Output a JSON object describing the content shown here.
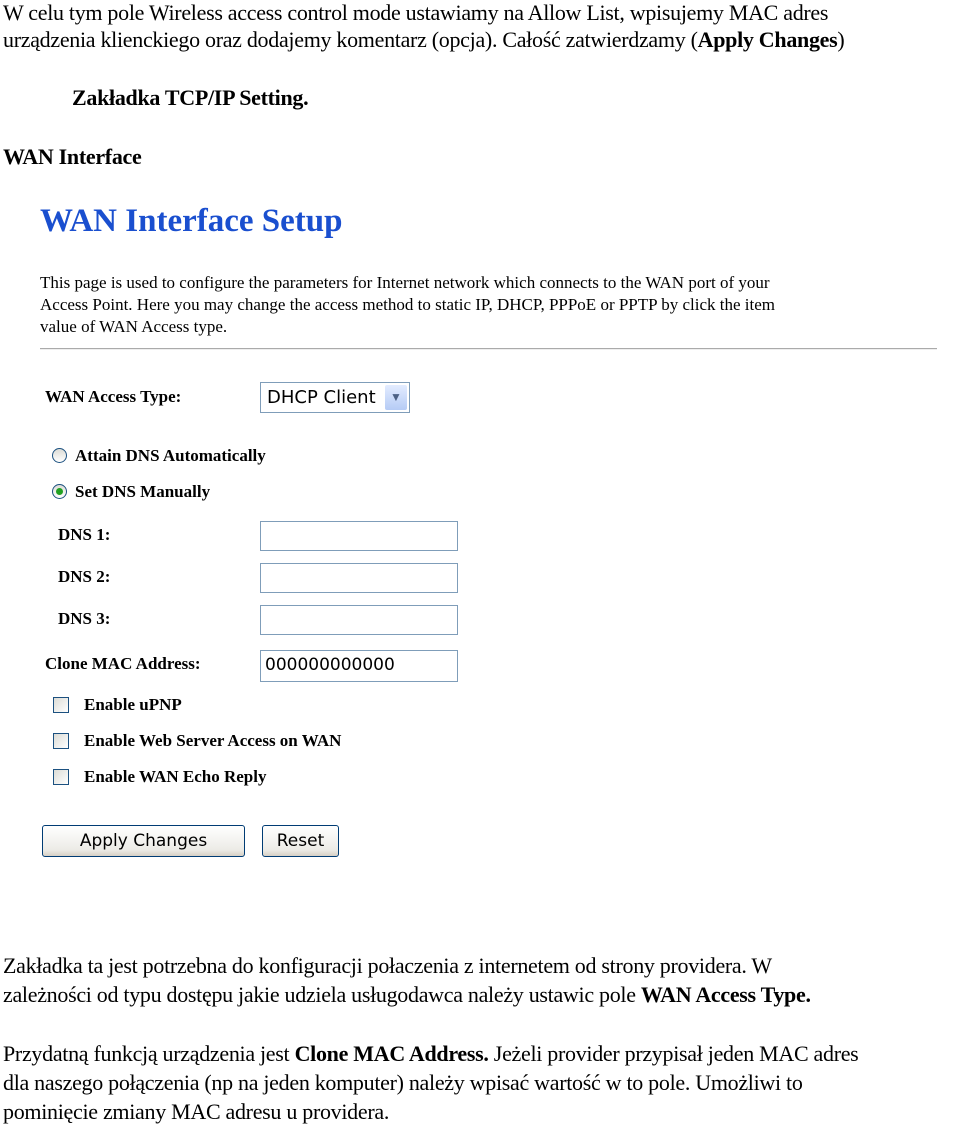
{
  "intro": {
    "line1": "W celu tym pole Wireless access control mode ustawiamy na Allow List, wpisujemy MAC adres",
    "line2_a": "urządzenia  klienckiego oraz dodajemy komentarz (opcja). Całość zatwierdzamy (",
    "line2_b": "Apply Changes",
    "line2_c": ")"
  },
  "section_heading": "Zakładka TCP/IP Setting.",
  "subheading": "WAN Interface",
  "screenshot": {
    "title": "WAN Interface Setup",
    "description": [
      "This page is used to configure the parameters for Internet network which connects to the WAN port of your",
      "Access Point. Here you may change the access method to static IP, DHCP, PPPoE or PPTP by click the item",
      "value of WAN Access type."
    ],
    "wan_access_type_label": "WAN Access Type:",
    "wan_access_type_value": "DHCP Client",
    "radio_auto": "Attain DNS Automatically",
    "radio_manual": "Set DNS Manually",
    "dns1_label": "DNS 1:",
    "dns1_value": "",
    "dns2_label": "DNS 2:",
    "dns2_value": "",
    "dns3_label": "DNS 3:",
    "dns3_value": "",
    "clone_mac_label": "Clone MAC Address:",
    "clone_mac_value": "000000000000",
    "cb_upnp": "Enable uPNP",
    "cb_web": "Enable Web Server Access on WAN",
    "cb_echo": "Enable WAN Echo Reply",
    "apply_button": "Apply Changes",
    "reset_button": "Reset",
    "title_color": "#1a4fcf"
  },
  "para1": {
    "a": " Zakładka ta jest potrzebna do konfiguracji połaczenia z internetem od strony providera. W",
    "b": "zależności od typu dostępu jakie udziela usługodawca należy ustawic pole ",
    "c": "WAN Access Type."
  },
  "para2": {
    "a": "Przydatną funkcją urządzenia jest ",
    "b": "Clone MAC Address.",
    "c": " Jeżeli provider przypisał jeden MAC adres",
    "line2": "dla naszego połączenia (np na jeden komputer) należy wpisać wartość w to pole. Umożliwi to",
    "line3": "pominięcie zmiany MAC adresu u providera."
  }
}
